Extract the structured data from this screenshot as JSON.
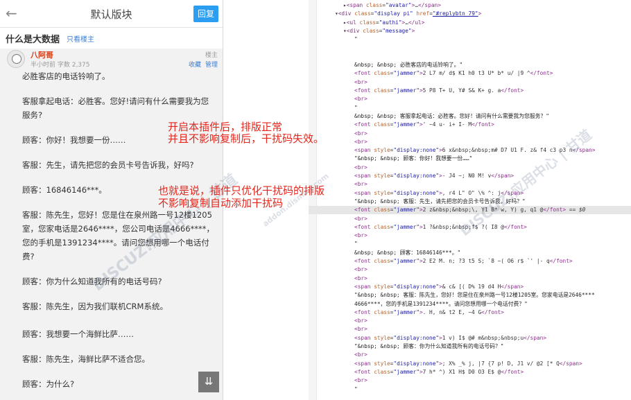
{
  "mobile": {
    "header_title": "默认版块",
    "reply_label": "回复",
    "thread_title": "什么是大数据",
    "only_owner": "只看楼主",
    "post": {
      "author": "八阿哥",
      "meta": "半小时前  字数 2,375",
      "floor": "楼主",
      "favorite": "收藏",
      "manage": "管理",
      "paragraphs": [
        "必胜客店的电话铃响了。",
        "客服拿起电话：必胜客。您好!请问有什么需要我为您服务?",
        "顾客：你好！我想要一份……",
        "客服：先生，请先把您的会员卡号告诉我，好吗?",
        "顾客：16846146***。",
        "客服：陈先生，您好！您是住在泉州路一号12楼1205室，您家电话是2646****，您公司电话是4666****，您的手机是1391234****。请问您想用哪一个电话付费?",
        "顾客：你为什么知道我所有的电话号码?",
        "客服：陈先生，因为我们联机CRM系统。",
        "",
        "顾客：我想要一个海鲜比萨……",
        "客服：陈先生，海鲜比萨不适合您。",
        "顾客：为什么?"
      ]
    },
    "fab_icon": "⇊"
  },
  "notes": {
    "line1": "开启本插件后，排版正常",
    "line2": "并且不影响复制后，干扰码失效。",
    "line3": "也就是说，插件只优化干扰码的排版",
    "line4": "不影响复制自动添加干扰码"
  },
  "watermark": {
    "text1": "DISCUZ!应用中心 | 甘道",
    "text2": "addon.dismall.com"
  },
  "devtools": {
    "lines": [
      {
        "indent": 50,
        "html": "▸<span class=\"tag\">&lt;span</span> <span class=\"attr\">class</span>=<span class=\"val\">\"avatar\"</span><span class=\"tag\">&gt;</span>…<span class=\"tag\">&lt;/span&gt;</span>"
      },
      {
        "indent": 38,
        "html": "▾<span class=\"tag\">&lt;div</span> <span class=\"attr\">class</span>=<span class=\"val\">\"display pi\"</span> <span class=\"attr\">href</span>=<span class=\"val\"><u>\"#replybtn_79\"</u></span><span class=\"tag\">&gt;</span>"
      },
      {
        "indent": 50,
        "html": "▸<span class=\"tag\">&lt;ul</span> <span class=\"attr\">class</span>=<span class=\"val\">\"authi\"</span><span class=\"tag\">&gt;</span>…<span class=\"tag\">&lt;/ul&gt;</span>"
      },
      {
        "indent": 50,
        "html": "▾<span class=\"tag\">&lt;div</span> <span class=\"attr\">class</span>=<span class=\"val\">\"message\"</span><span class=\"tag\">&gt;</span>"
      },
      {
        "indent": 66,
        "html": "<span class=\"txt\">\"</span>"
      },
      {
        "indent": 66,
        "html": ""
      },
      {
        "indent": 66,
        "html": ""
      },
      {
        "indent": 66,
        "html": "<span class=\"txt\">&amp;nbsp; &amp;nbsp; 必胜客店的电话铃响了。\"</span>"
      },
      {
        "indent": 66,
        "html": "<span class=\"tag\">&lt;font</span> <span class=\"attr\">class</span>=<span class=\"val\">\"jammer\"</span><span class=\"tag\">&gt;</span>2 L7 m/ d$ K1 h0 t3 U* b* u/ |9 ^<span class=\"tag\">&lt;/font&gt;</span>"
      },
      {
        "indent": 66,
        "html": "<span class=\"tag\">&lt;br&gt;</span>"
      },
      {
        "indent": 66,
        "html": "<span class=\"tag\">&lt;font</span> <span class=\"attr\">class</span>=<span class=\"val\">\"jammer\"</span><span class=\"tag\">&gt;</span>5 P8 T+ U, Y# S& K+ g. a<span class=\"tag\">&lt;/font&gt;</span>"
      },
      {
        "indent": 66,
        "html": "<span class=\"tag\">&lt;br&gt;</span>"
      },
      {
        "indent": 66,
        "html": "<span class=\"txt\">\"</span>"
      },
      {
        "indent": 66,
        "html": "<span class=\"txt\">&amp;nbsp; &amp;nbsp; 客服拿起电话：必胜客。您好！请问有什么需要我为您服务？\"</span>"
      },
      {
        "indent": 66,
        "html": "<span class=\"tag\">&lt;font</span> <span class=\"attr\">class</span>=<span class=\"val\">\"jammer\"</span><span class=\"tag\">&gt;</span>' ~4 u- i+ I- M<span class=\"tag\">&lt;/font&gt;</span>"
      },
      {
        "indent": 66,
        "html": "<span class=\"tag\">&lt;br&gt;</span>"
      },
      {
        "indent": 66,
        "html": "<span class=\"tag\">&lt;br&gt;</span>"
      },
      {
        "indent": 66,
        "html": "<span class=\"tag\">&lt;span</span> <span class=\"attr\">style</span>=<span class=\"val\">\"display:none\"</span><span class=\"tag\">&gt;</span>6 x&amp;nbsp;&amp;nbsp;m# D7 U1 F. z& f4 c3 p3 n<span class=\"tag\">&lt;/span&gt;</span>"
      },
      {
        "indent": 66,
        "html": "<span class=\"txt\">\"&amp;nbsp; &amp;nbsp; 顾客：你好！我想要一份……\"</span>"
      },
      {
        "indent": 66,
        "html": "<span class=\"tag\">&lt;br&gt;</span>"
      },
      {
        "indent": 66,
        "html": "<span class=\"tag\">&lt;span</span> <span class=\"attr\">style</span>=<span class=\"val\">\"display:none\"</span><span class=\"tag\">&gt;</span>- J4 ~; N0 M! v<span class=\"tag\">&lt;/span&gt;</span>"
      },
      {
        "indent": 66,
        "html": "<span class=\"tag\">&lt;br&gt;</span>"
      },
      {
        "indent": 66,
        "html": "<span class=\"tag\">&lt;span</span> <span class=\"attr\">style</span>=<span class=\"val\">\"display:none\"</span><span class=\"tag\">&gt;</span>, r4 L\" O\" \\% ^: j<span class=\"tag\">&lt;/span&gt;</span>"
      },
      {
        "indent": 66,
        "html": "<span class=\"txt\">\"&amp;nbsp; &amp;nbsp; 客服：先生，请先把您的会员卡号告诉我，好吗？\"</span>"
      },
      {
        "indent": 66,
        "sel": true,
        "html": "<span class=\"tag\">&lt;font</span> <span class=\"attr\">class</span>=<span class=\"val\">\"jammer\"</span><span class=\"tag\">&gt;</span>2 z&amp;nbsp;&amp;nbsp;\\, Y1 B* w, Y) g, q1 @<span class=\"tag\">&lt;/font&gt;</span> == <i>$0</i>"
      },
      {
        "indent": 66,
        "html": "<span class=\"tag\">&lt;br&gt;</span>"
      },
      {
        "indent": 66,
        "html": "<span class=\"tag\">&lt;font</span> <span class=\"attr\">class</span>=<span class=\"val\">\"jammer\"</span><span class=\"tag\">&gt;</span>1 ?&amp;nbsp;&amp;nbsp;f$ ?( I8 @<span class=\"tag\">&lt;/font&gt;</span>"
      },
      {
        "indent": 66,
        "html": "<span class=\"tag\">&lt;br&gt;</span>"
      },
      {
        "indent": 66,
        "html": "<span class=\"txt\">\"</span>"
      },
      {
        "indent": 66,
        "html": "<span class=\"txt\">&amp;nbsp; &amp;nbsp; 顾客：16846146***。\"</span>"
      },
      {
        "indent": 66,
        "html": "<span class=\"tag\">&lt;font</span> <span class=\"attr\">class</span>=<span class=\"val\">\"jammer\"</span><span class=\"tag\">&gt;</span>2 E2 M. n; ?3 t5 S; `8 ~( O6 r$ `' |- q<span class=\"tag\">&lt;/font&gt;</span>"
      },
      {
        "indent": 66,
        "html": "<span class=\"tag\">&lt;br&gt;</span>"
      },
      {
        "indent": 66,
        "html": "<span class=\"tag\">&lt;br&gt;</span>"
      },
      {
        "indent": 66,
        "html": "<span class=\"tag\">&lt;span</span> <span class=\"attr\">style</span>=<span class=\"val\">\"display:none\"</span><span class=\"tag\">&gt;</span>& c& [( D% 19 d4 H<span class=\"tag\">&lt;/span&gt;</span>"
      },
      {
        "indent": 66,
        "html": "<span class=\"txt\">\"&amp;nbsp; &amp;nbsp; 客服：陈先生，您好！您是住在泉州路一号12楼1205室。您家电话是2646****</span>"
      },
      {
        "indent": 66,
        "html": "<span class=\"txt\">4666****，您的手机是1391234****。请问您想用哪一个电话付费？\"</span>"
      },
      {
        "indent": 66,
        "html": "<span class=\"tag\">&lt;font</span> <span class=\"attr\">class</span>=<span class=\"val\">\"jammer\"</span><span class=\"tag\">&gt;</span>. H, n& t2 E, ~4 G<span class=\"tag\">&lt;/font&gt;</span>"
      },
      {
        "indent": 66,
        "html": "<span class=\"tag\">&lt;br&gt;</span>"
      },
      {
        "indent": 66,
        "html": "<span class=\"tag\">&lt;br&gt;</span>"
      },
      {
        "indent": 66,
        "html": "<span class=\"tag\">&lt;span</span> <span class=\"attr\">style</span>=<span class=\"val\">\"display:none\"</span><span class=\"tag\">&gt;</span>1 v) I$ @# m&amp;nbsp;&amp;nbsp;u<span class=\"tag\">&lt;/span&gt;</span>"
      },
      {
        "indent": 66,
        "html": "<span class=\"txt\">\"&amp;nbsp; &amp;nbsp; 顾客：你为什么知道我所有的电话号码？\"</span>"
      },
      {
        "indent": 66,
        "html": "<span class=\"tag\">&lt;br&gt;</span>"
      },
      {
        "indent": 66,
        "html": "<span class=\"tag\">&lt;span</span> <span class=\"attr\">style</span>=<span class=\"val\">\"display:none\"</span><span class=\"tag\">&gt;</span>; X% _% j, |7 {7 p! D, J1 v/ @2 [* Q<span class=\"tag\">&lt;/span&gt;</span>"
      },
      {
        "indent": 66,
        "html": "<span class=\"tag\">&lt;font</span> <span class=\"attr\">class</span>=<span class=\"val\">\"jammer\"</span><span class=\"tag\">&gt;</span>7 h* ^) X1 H$ D0 O3 E$ @<span class=\"tag\">&lt;/font&gt;</span>"
      },
      {
        "indent": 66,
        "html": "<span class=\"tag\">&lt;br&gt;</span>"
      },
      {
        "indent": 66,
        "html": "<span class=\"txt\">\"</span>"
      }
    ]
  }
}
